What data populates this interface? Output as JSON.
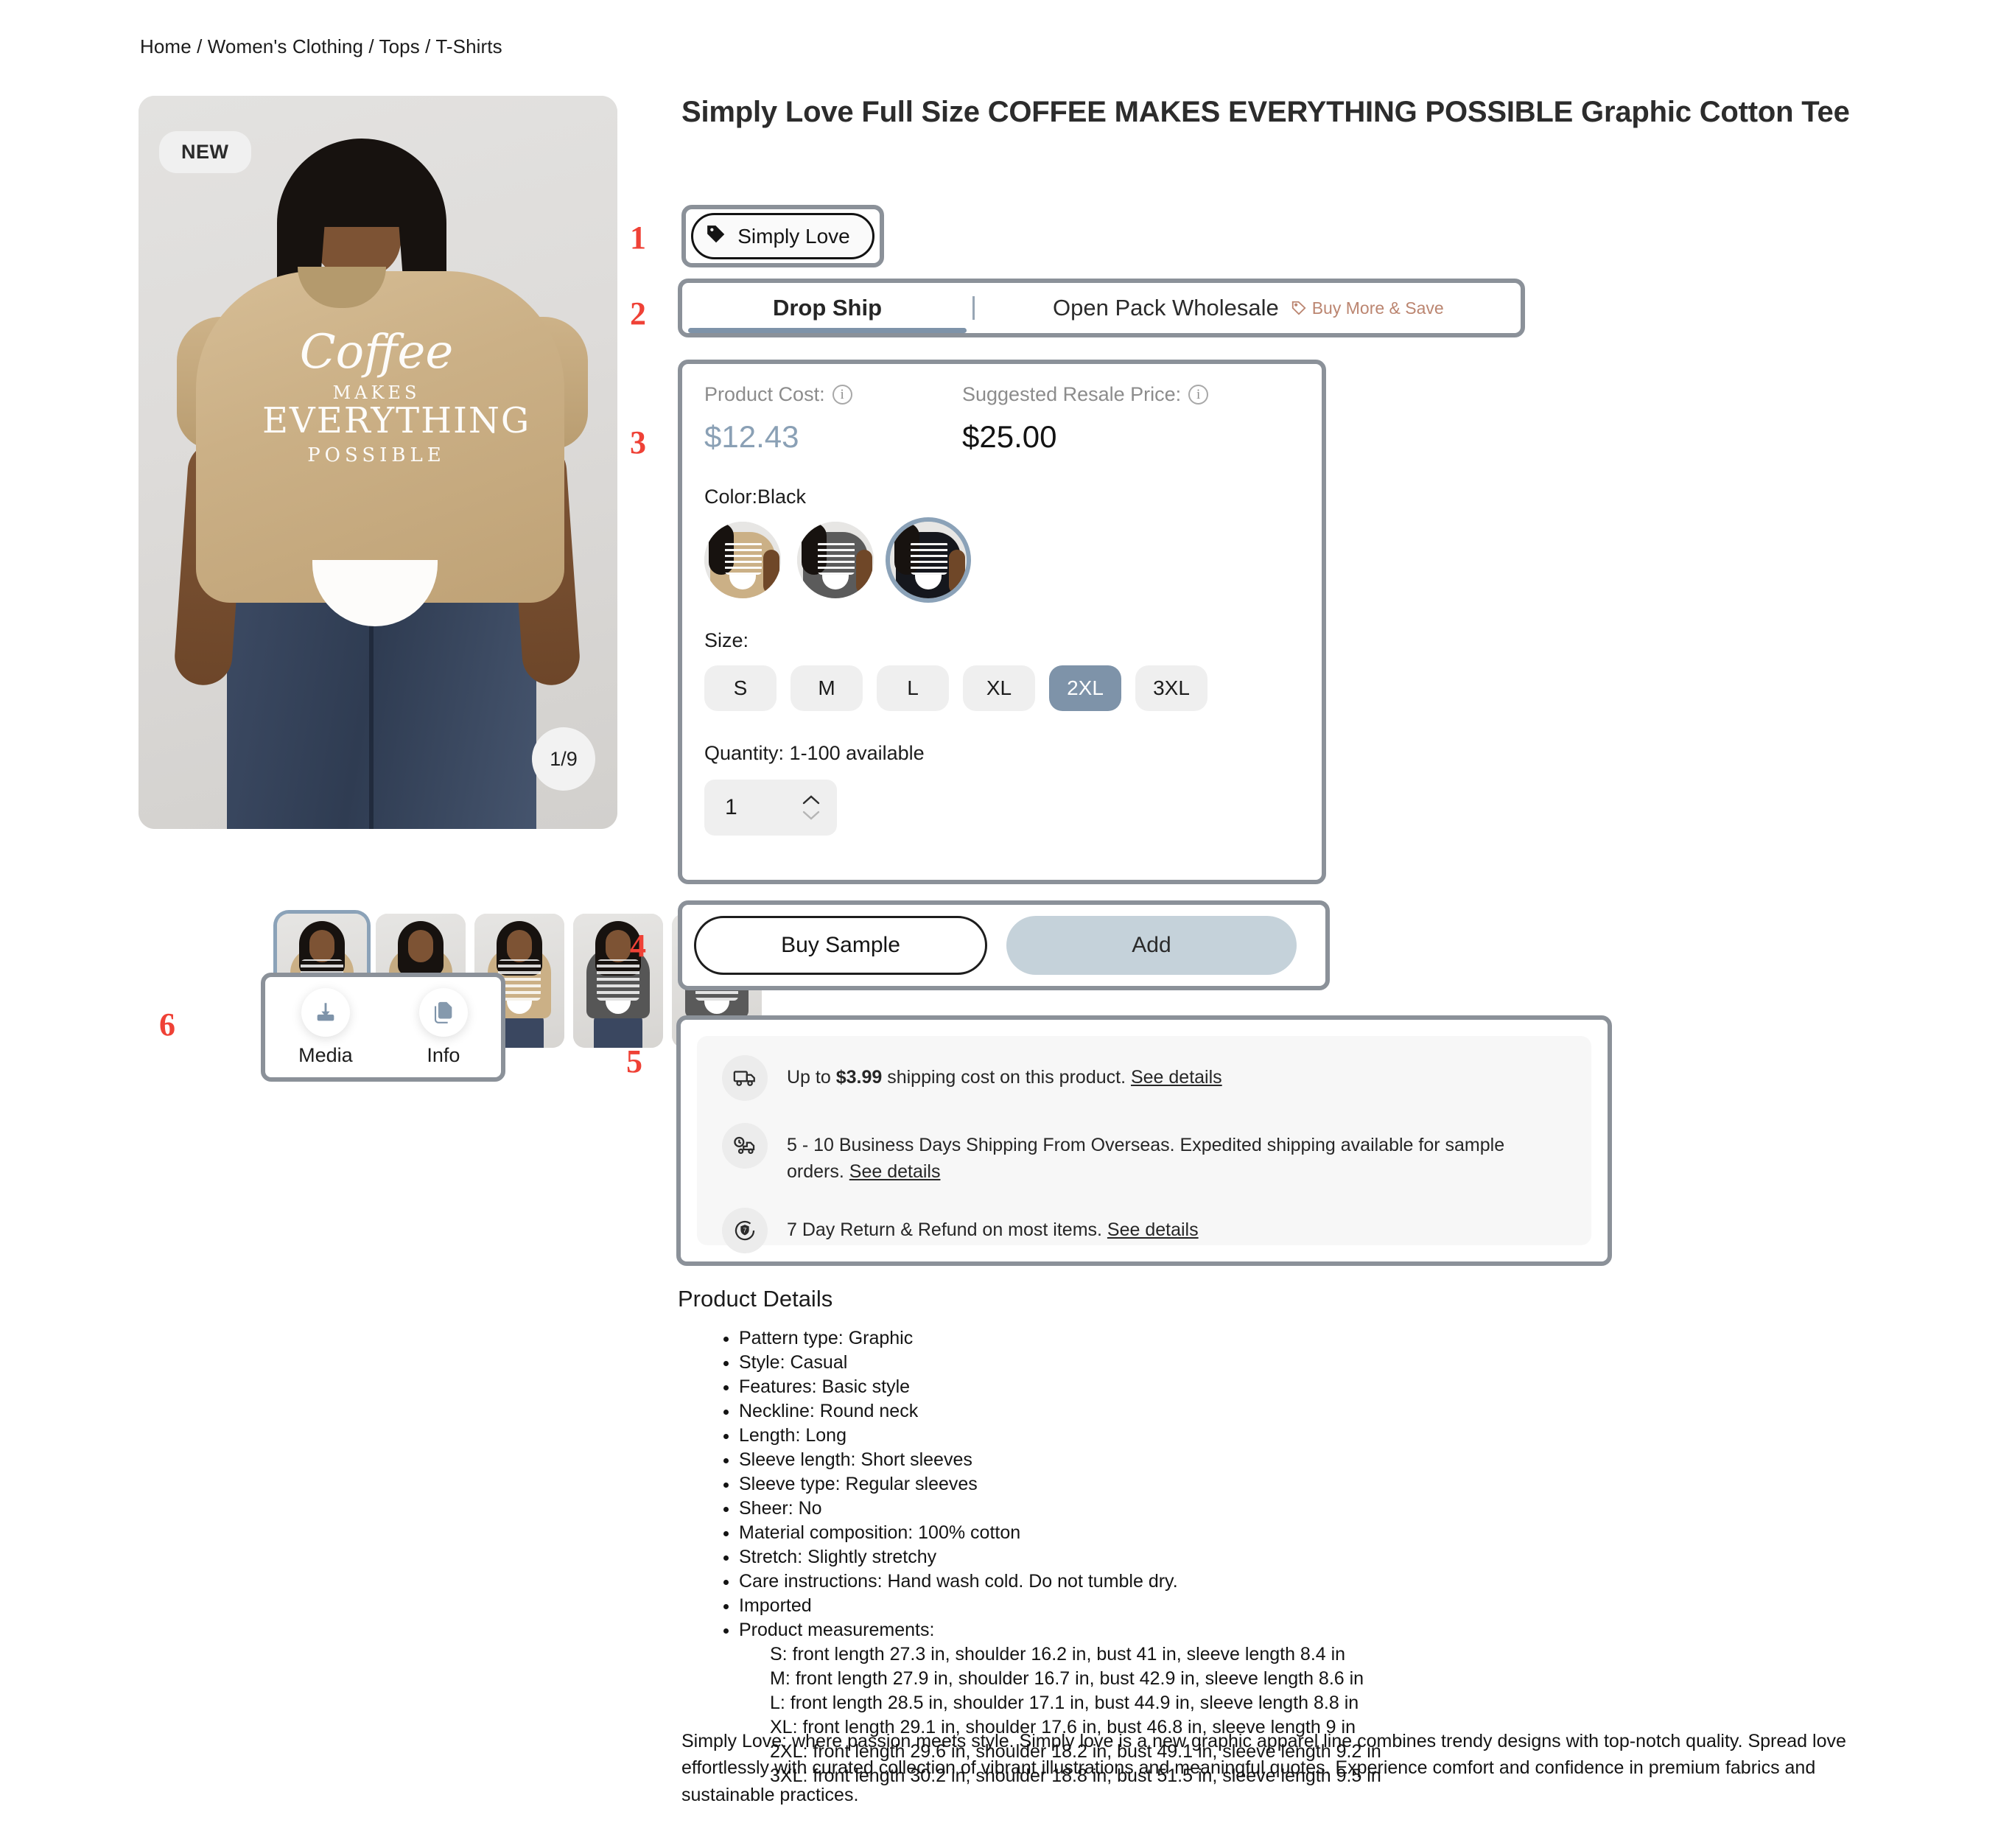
{
  "breadcrumb": "Home / Women's Clothing / Tops / T-Shirts",
  "gallery": {
    "new_badge": "NEW",
    "counter": "1/9",
    "thumbnail_count": 5,
    "selected_thumbnail_index": 0
  },
  "media_info": {
    "annotation": "6",
    "media_label": "Media",
    "media_icon": "download-icon",
    "info_label": "Info",
    "info_icon": "documents-icon"
  },
  "product": {
    "title": "Simply Love Full Size COFFEE MAKES EVERYTHING POSSIBLE Graphic Cotton Tee"
  },
  "brand": {
    "annotation": "1",
    "name": "Simply Love",
    "icon": "tag-icon"
  },
  "tabs": {
    "annotation": "2",
    "items": [
      {
        "label": "Drop Ship",
        "selected": true
      },
      {
        "label": "Open Pack Wholesale",
        "selected": false
      }
    ],
    "promo_label": "Buy More & Save",
    "promo_icon": "tag-icon",
    "promo_color": "#bb8570",
    "active_underline_color": "#7e93a9"
  },
  "variant": {
    "annotation": "3",
    "cost_label": "Product Cost:",
    "cost_value": "$12.43",
    "cost_color": "#8aa0b5",
    "resale_label": "Suggested Resale Price:",
    "resale_value": "$25.00",
    "info_icon": "info-icon",
    "color_label": "Color:Black",
    "color_selected_index": 2,
    "size_label": "Size:",
    "sizes": [
      "S",
      "M",
      "L",
      "XL",
      "2XL",
      "3XL"
    ],
    "selected_size": "2XL",
    "selected_size_color": "#7e93a9",
    "quantity_label": "Quantity: 1-100 available",
    "quantity_value": "1",
    "increment_icon": "chevron-up-icon",
    "decrement_icon": "chevron-down-icon"
  },
  "actions": {
    "annotation": "4",
    "buy_sample_label": "Buy Sample",
    "add_label": "Add",
    "add_color": "#c5d2da"
  },
  "shipping": {
    "annotation": "5",
    "rows": [
      {
        "icon": "truck-icon",
        "prefix": "Up to ",
        "amount": "$3.99",
        "suffix": " shipping cost on this product. ",
        "link": "See details"
      },
      {
        "icon": "truck-clock-icon",
        "prefix": "5 - 10 Business Days Shipping From Overseas. Expedited shipping available for sample orders. ",
        "amount": "",
        "suffix": "",
        "link": "See details"
      },
      {
        "icon": "shield-return-icon",
        "prefix": "7 Day Return & Refund on most items. ",
        "amount": "",
        "suffix": "",
        "link": "See details"
      }
    ]
  },
  "details": {
    "heading": "Product Details",
    "bullets": [
      "Pattern type: Graphic",
      "Style: Casual",
      "Features: Basic style",
      "Neckline: Round neck",
      "Length: Long",
      "Sleeve length: Short sleeves",
      "Sleeve type: Regular sleeves",
      "Sheer: No",
      "Material composition: 100% cotton",
      "Stretch: Slightly stretchy",
      "Care instructions: Hand wash cold. Do not tumble dry.",
      "Imported",
      "Product measurements:"
    ],
    "measurements": [
      "S: front length 27.3 in, shoulder 16.2 in, bust 41 in, sleeve length 8.4 in",
      "M: front length 27.9 in, shoulder 16.7 in, bust 42.9 in, sleeve length 8.6 in",
      "L: front length 28.5 in, shoulder 17.1 in, bust 44.9 in, sleeve length 8.8 in",
      "XL: front length 29.1 in, shoulder 17.6 in, bust 46.8 in, sleeve length 9 in",
      "2XL: front length 29.6 in, shoulder 18.2 in, bust 49.1 in, sleeve length 9.2 in",
      "3XL: front length 30.2 in, shoulder 18.8 in, bust 51.5 in, sleeve length 9.5 in"
    ],
    "description": "Simply Love: where passion meets style. Simply love is a new graphic apparel line combines trendy designs with top-notch quality. Spread love effortlessly with curated collection of vibrant illustrations and meaningful quotes. Experience comfort and confidence in premium fabrics and sustainable practices."
  },
  "print_graphic": {
    "line1": "Coffee",
    "line2": "MAKES",
    "line3": "EVERYTHING",
    "line4": "POSSIBLE"
  }
}
